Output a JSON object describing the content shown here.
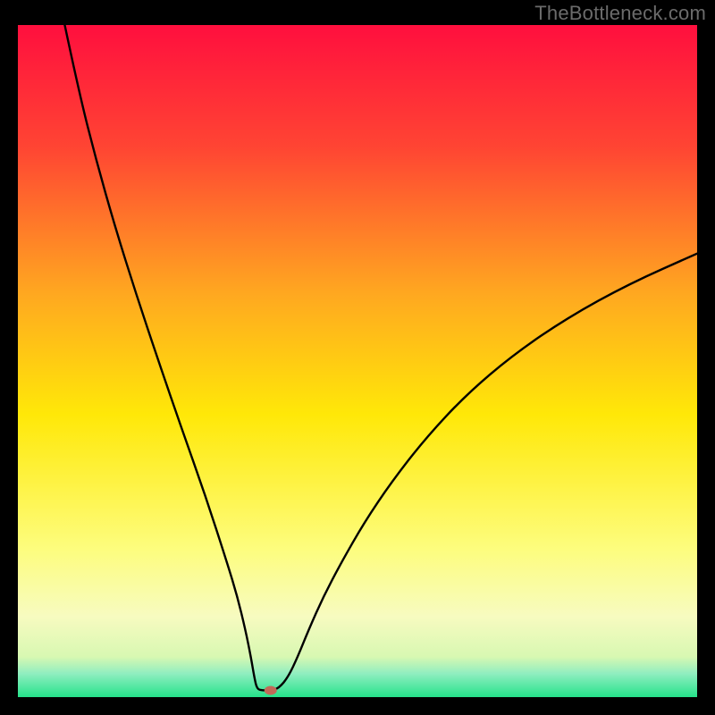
{
  "watermark": "TheBottleneck.com",
  "chart_data": {
    "type": "line",
    "title": "",
    "xlabel": "",
    "ylabel": "",
    "x_range": [
      0,
      100
    ],
    "y_range": [
      0,
      100
    ],
    "background_gradient_stops": [
      {
        "pos": 0.0,
        "color": "#ff0f3e"
      },
      {
        "pos": 0.18,
        "color": "#ff4433"
      },
      {
        "pos": 0.4,
        "color": "#ffa820"
      },
      {
        "pos": 0.58,
        "color": "#ffe808"
      },
      {
        "pos": 0.78,
        "color": "#fdfd7e"
      },
      {
        "pos": 0.88,
        "color": "#f7fbc0"
      },
      {
        "pos": 0.94,
        "color": "#d8f8b2"
      },
      {
        "pos": 0.965,
        "color": "#90eec0"
      },
      {
        "pos": 1.0,
        "color": "#25e28a"
      }
    ],
    "curve": [
      {
        "x": 6.9,
        "y": 100.0
      },
      {
        "x": 9.0,
        "y": 90.0
      },
      {
        "x": 11.5,
        "y": 80.0
      },
      {
        "x": 14.3,
        "y": 70.0
      },
      {
        "x": 17.4,
        "y": 60.0
      },
      {
        "x": 20.7,
        "y": 50.0
      },
      {
        "x": 24.1,
        "y": 40.0
      },
      {
        "x": 27.6,
        "y": 30.0
      },
      {
        "x": 30.8,
        "y": 20.0
      },
      {
        "x": 32.3,
        "y": 15.0
      },
      {
        "x": 33.5,
        "y": 10.0
      },
      {
        "x": 34.3,
        "y": 6.0
      },
      {
        "x": 34.8,
        "y": 3.0
      },
      {
        "x": 35.2,
        "y": 1.2
      },
      {
        "x": 36.0,
        "y": 1.0
      },
      {
        "x": 37.2,
        "y": 1.0
      },
      {
        "x": 38.4,
        "y": 1.3
      },
      {
        "x": 39.8,
        "y": 3.0
      },
      {
        "x": 41.2,
        "y": 6.0
      },
      {
        "x": 42.8,
        "y": 10.0
      },
      {
        "x": 45.0,
        "y": 15.0
      },
      {
        "x": 47.6,
        "y": 20.0
      },
      {
        "x": 51.0,
        "y": 26.0
      },
      {
        "x": 55.0,
        "y": 32.0
      },
      {
        "x": 60.0,
        "y": 38.5
      },
      {
        "x": 66.0,
        "y": 45.0
      },
      {
        "x": 73.0,
        "y": 51.0
      },
      {
        "x": 81.0,
        "y": 56.5
      },
      {
        "x": 90.0,
        "y": 61.5
      },
      {
        "x": 100.0,
        "y": 66.0
      }
    ],
    "marker": {
      "x": 37.2,
      "y": 1.0,
      "color": "#c16a58",
      "rx": 7,
      "ry": 5
    }
  }
}
